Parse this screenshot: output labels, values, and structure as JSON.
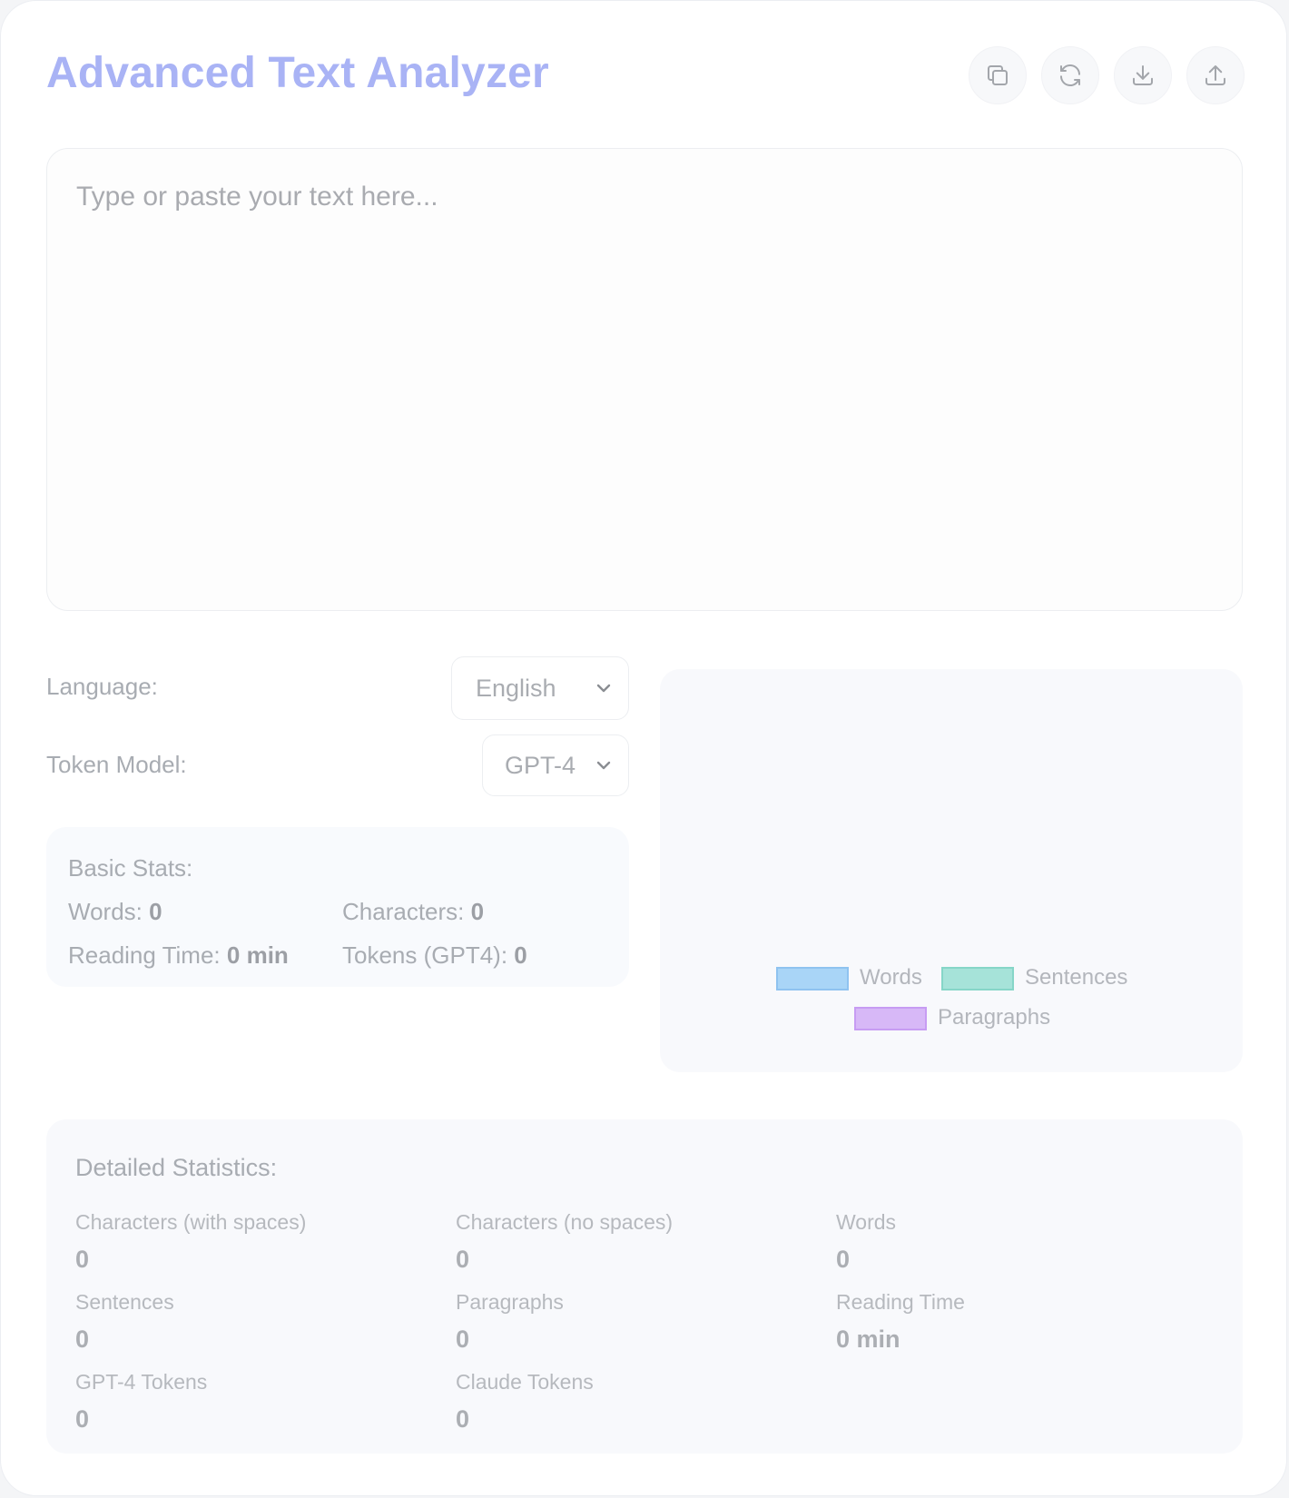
{
  "header": {
    "title": "Advanced Text Analyzer"
  },
  "toolbar": {
    "buttons": [
      {
        "icon": "copy-icon"
      },
      {
        "icon": "refresh-icon"
      },
      {
        "icon": "download-icon"
      },
      {
        "icon": "upload-icon"
      }
    ]
  },
  "editor": {
    "placeholder": "Type or paste your text here...",
    "value": ""
  },
  "controls": {
    "language_label": "Language:",
    "language_value": "English",
    "token_model_label": "Token Model:",
    "token_model_value": "GPT-4"
  },
  "basic_stats": {
    "heading": "Basic Stats:",
    "words_label": "Words:",
    "words_value": "0",
    "characters_label": "Characters:",
    "characters_value": "0",
    "reading_time_label": "Reading Time:",
    "reading_time_value": "0 min",
    "tokens_label": "Tokens (GPT4):",
    "tokens_value": "0"
  },
  "chart_data": {
    "type": "bar",
    "categories": [],
    "series": [
      {
        "name": "Words",
        "values": []
      },
      {
        "name": "Sentences",
        "values": []
      },
      {
        "name": "Paragraphs",
        "values": []
      }
    ],
    "colors": [
      "#a9d5f7",
      "#a6e3d9",
      "#d7b8f7"
    ],
    "legend_position": "bottom"
  },
  "detailed_stats": {
    "heading": "Detailed Statistics:",
    "items": [
      {
        "label": "Characters (with spaces)",
        "value": "0"
      },
      {
        "label": "Characters (no spaces)",
        "value": "0"
      },
      {
        "label": "Words",
        "value": "0"
      },
      {
        "label": "Sentences",
        "value": "0"
      },
      {
        "label": "Paragraphs",
        "value": "0"
      },
      {
        "label": "Reading Time",
        "value": "0 min"
      },
      {
        "label": "GPT-4 Tokens",
        "value": "0"
      },
      {
        "label": "Claude Tokens",
        "value": "0"
      }
    ]
  }
}
